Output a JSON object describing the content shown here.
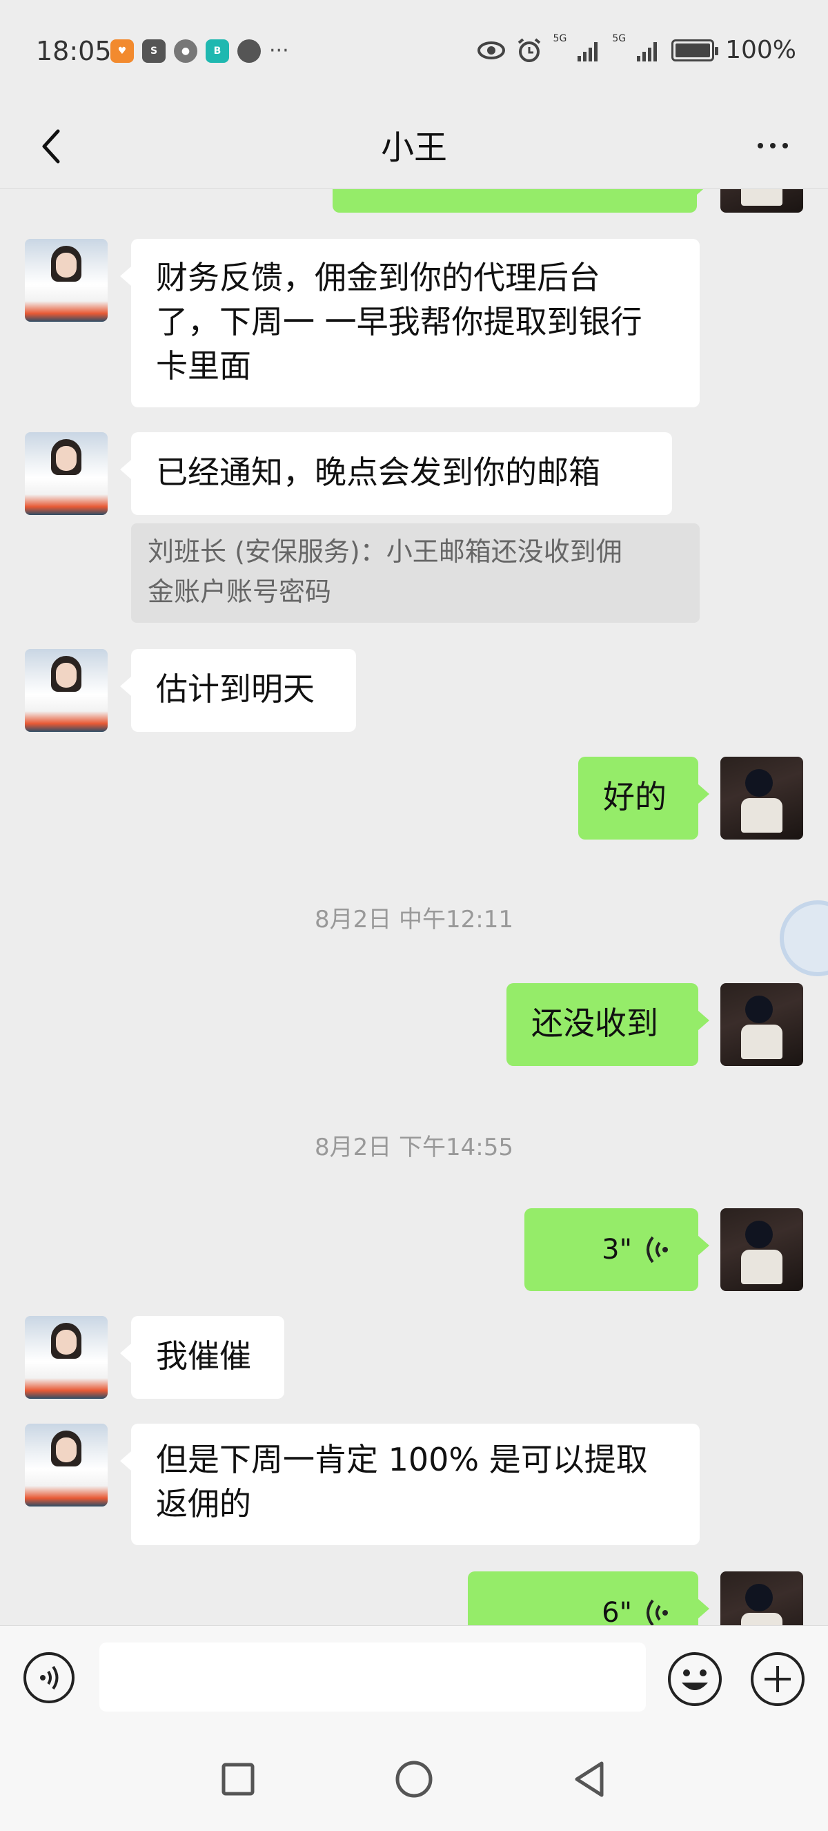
{
  "status_bar": {
    "time": "18:05",
    "app_icons": [
      "taobao-icon",
      "sina-icon",
      "wechat-icon",
      "boss-icon",
      "message-icon"
    ],
    "more_label": "···",
    "network": [
      "5G",
      "5G"
    ],
    "battery_text": "100%"
  },
  "header": {
    "title": "小王"
  },
  "messages": [
    {
      "id": 0,
      "side": "out",
      "type": "text",
      "text": "",
      "partial": true
    },
    {
      "id": 1,
      "side": "in",
      "type": "text",
      "lines": [
        "财务反馈，佣金到你的代理后台",
        "了，下周一 一早我帮你提取到银行",
        "卡里面"
      ]
    },
    {
      "id": 2,
      "side": "in",
      "type": "text",
      "text": "已经通知，晚点会发到你的邮箱"
    },
    {
      "id": 3,
      "type": "quote",
      "lines": [
        "刘班长 (安保服务)：小王邮箱还没收到佣",
        "金账户账号密码"
      ]
    },
    {
      "id": 4,
      "side": "in",
      "type": "text",
      "text": "估计到明天"
    },
    {
      "id": 5,
      "side": "out",
      "type": "text",
      "text": "好的"
    },
    {
      "id": 6,
      "type": "timestamp",
      "text": "8月2日 中午12:11"
    },
    {
      "id": 7,
      "side": "out",
      "type": "text",
      "text": "还没收到"
    },
    {
      "id": 8,
      "type": "timestamp",
      "text": "8月2日 下午14:55"
    },
    {
      "id": 9,
      "side": "out",
      "type": "voice",
      "duration": "3\""
    },
    {
      "id": 10,
      "side": "in",
      "type": "text",
      "text": "我催催"
    },
    {
      "id": 11,
      "side": "in",
      "type": "text",
      "lines": [
        "但是下周一肯定 100% 是可以提取",
        "返佣的"
      ]
    },
    {
      "id": 12,
      "side": "out",
      "type": "voice",
      "duration": "6\"",
      "partial": true
    }
  ],
  "colors": {
    "background": "#ededed",
    "bubble_out": "#95ec69",
    "bubble_in": "#ffffff",
    "timestamp": "#999999"
  },
  "input_bar": {
    "placeholder": ""
  }
}
